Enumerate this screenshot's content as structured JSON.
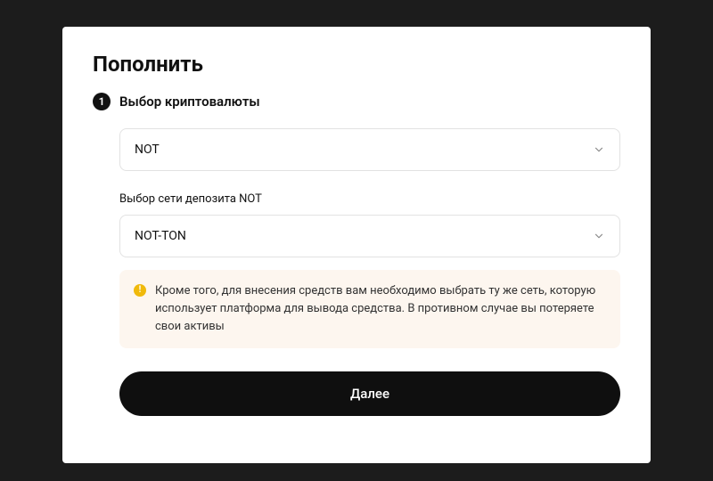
{
  "page": {
    "title": "Пополнить"
  },
  "step1": {
    "number": "1",
    "label": "Выбор криптовалюты",
    "currency_selected": "NOT",
    "network_label": "Выбор сети депозита NOT",
    "network_selected": "NOT-TON",
    "warning": "Кроме того, для внесения средств вам необходимо выбрать ту же сеть, которую использует платформа для вывода средства. В противном случае вы потеряете свои активы"
  },
  "actions": {
    "next": "Далее"
  }
}
